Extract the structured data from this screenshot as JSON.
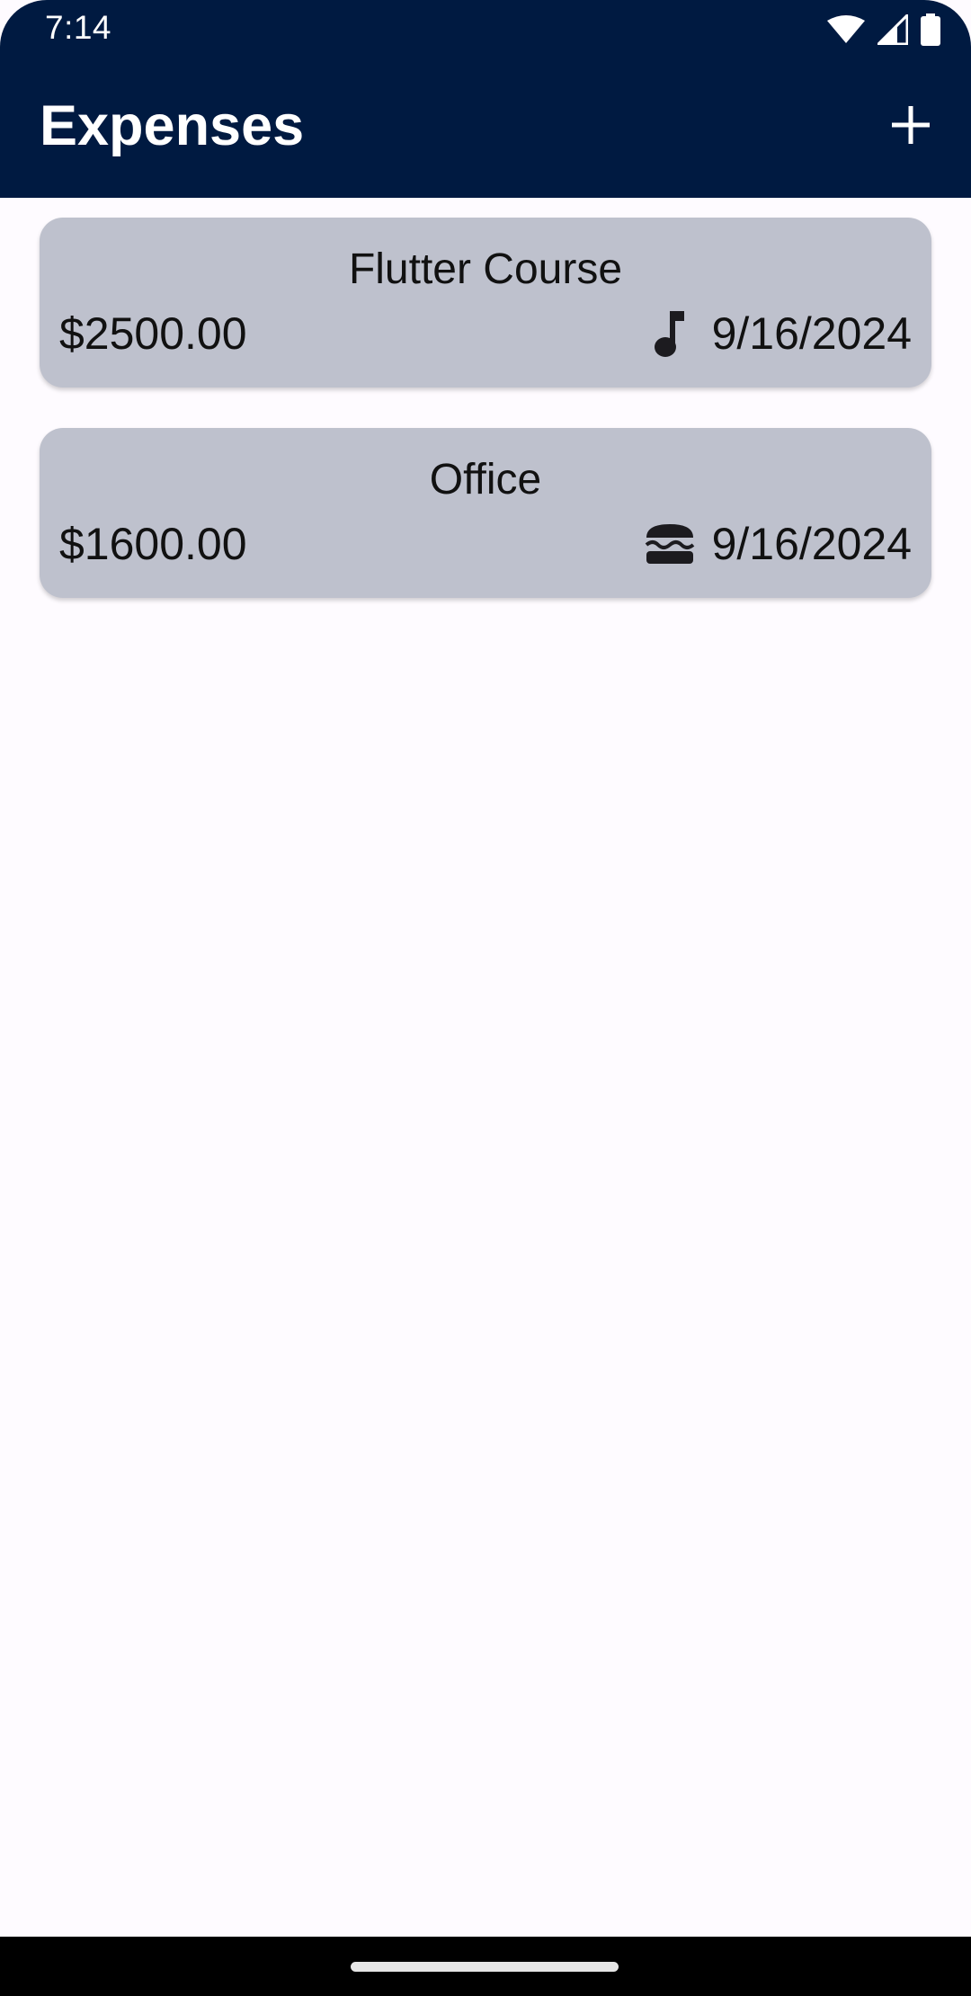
{
  "status_bar": {
    "time": "7:14",
    "icons": [
      "wifi-icon",
      "signal-icon",
      "battery-icon"
    ]
  },
  "app_bar": {
    "title": "Expenses",
    "add_icon": "plus-icon"
  },
  "expenses": [
    {
      "title": "Flutter Course",
      "amount": "$2500.00",
      "category_icon": "music-note-icon",
      "date": "9/16/2024"
    },
    {
      "title": "Office",
      "amount": "$1600.00",
      "category_icon": "burger-icon",
      "date": "9/16/2024"
    }
  ],
  "colors": {
    "app_bar": "#001a41",
    "card": "#bec1cd",
    "background": "#fefbff"
  }
}
